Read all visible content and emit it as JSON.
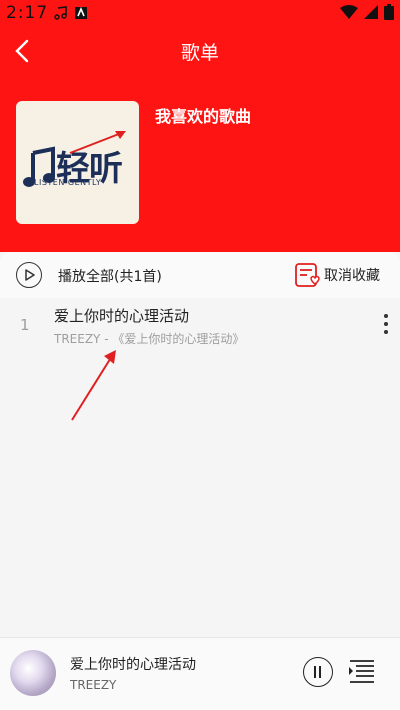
{
  "status_bar": {
    "time": "2:17"
  },
  "navbar": {
    "title": "歌单"
  },
  "playlist": {
    "name": "我喜欢的歌曲",
    "cover_logo_text": "轻听",
    "cover_logo_sub": "LISTEN GENTLY"
  },
  "actions": {
    "play_all_label": "播放全部(共1首)",
    "unfavorite_label": "取消收藏"
  },
  "songs": [
    {
      "index": "1",
      "title": "爱上你时的心理活动",
      "subtitle": "TREEZY - 《爱上你时的心理活动》"
    }
  ],
  "now_playing": {
    "title": "爱上你时的心理活动",
    "artist": "TREEZY"
  },
  "colors": {
    "header_red": "#ff1414",
    "annotation_red": "#e02020"
  }
}
